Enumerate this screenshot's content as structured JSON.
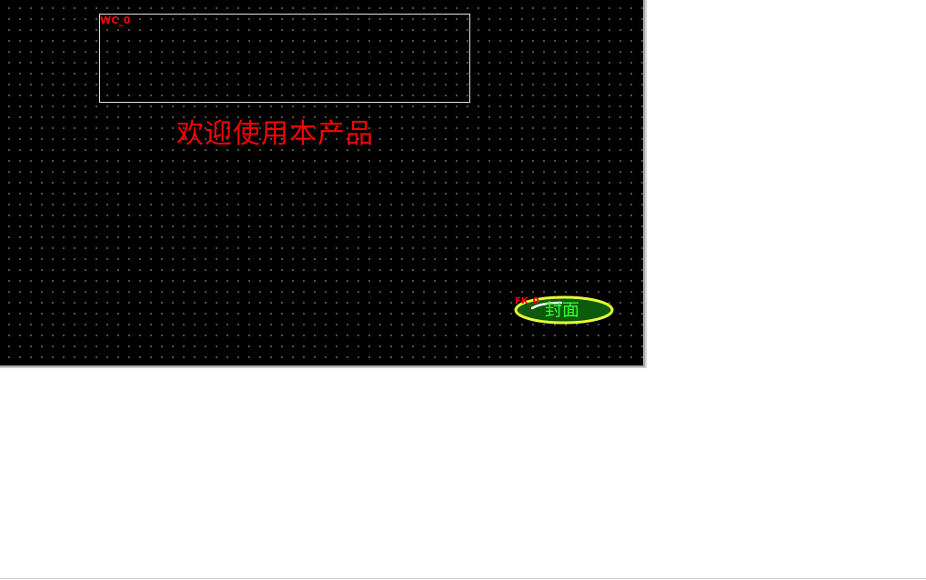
{
  "canvas": {
    "background": "#000000",
    "grid_dot_color": "#8a8a8a"
  },
  "widgets": {
    "frame": {
      "id_label": "WC_0",
      "border_color": "#e6e6e6"
    },
    "welcome": {
      "text": "欢迎使用本产品",
      "color": "#ff0000"
    },
    "cover_button": {
      "id_label": "FK_0",
      "label": "封面",
      "fill_color": "#0c5a0c",
      "ring_color": "#e6ff33",
      "text_color": "#33ff33",
      "icon": "pointer-indicator-icon"
    }
  }
}
